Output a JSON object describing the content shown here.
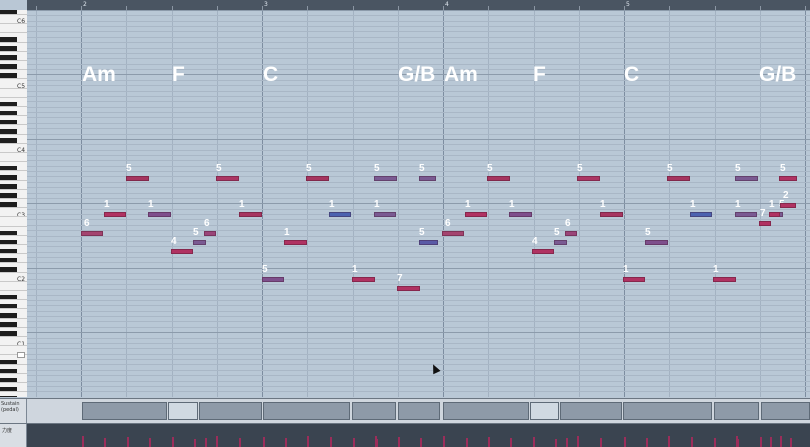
{
  "ruler": {
    "bars": [
      "2",
      "3",
      "4",
      "5"
    ]
  },
  "keyboard": {
    "octave_labels": [
      "C6",
      "C5",
      "C4",
      "C3",
      "C2",
      "C1"
    ]
  },
  "chords": [
    "Am",
    "F",
    "C",
    "G/B",
    "Am",
    "F",
    "C",
    "G/B"
  ],
  "notes": [
    {
      "finger": "6",
      "color": "#a4446f"
    },
    {
      "finger": "1",
      "color": "#b03262"
    },
    {
      "finger": "5",
      "color": "#a6345f"
    },
    {
      "finger": "1",
      "color": "#7e4f8c"
    },
    {
      "finger": "4",
      "color": "#b03262"
    },
    {
      "finger": "5",
      "color": "#7a5a92"
    },
    {
      "finger": "6",
      "color": "#9a4478"
    },
    {
      "finger": "5",
      "color": "#ac3664"
    },
    {
      "finger": "1",
      "color": "#a6345f"
    },
    {
      "finger": "5",
      "color": "#7e4f8c"
    },
    {
      "finger": "1",
      "color": "#b03262"
    },
    {
      "finger": "5",
      "color": "#a6345f"
    },
    {
      "finger": "1",
      "color": "#4c62b0"
    },
    {
      "finger": "1",
      "color": "#b03262"
    },
    {
      "finger": "5",
      "color": "#7a5a92"
    },
    {
      "finger": "1",
      "color": "#7a5a92"
    },
    {
      "finger": "5",
      "color": "#7a5a92"
    },
    {
      "finger": "7",
      "color": "#b03262"
    },
    {
      "finger": "5",
      "color": "#5a5aa6"
    },
    {
      "finger": "6",
      "color": "#a4446f"
    },
    {
      "finger": "1",
      "color": "#b03262"
    },
    {
      "finger": "5",
      "color": "#a6345f"
    },
    {
      "finger": "1",
      "color": "#7e4f8c"
    },
    {
      "finger": "4",
      "color": "#b03262"
    },
    {
      "finger": "5",
      "color": "#7a5a92"
    },
    {
      "finger": "6",
      "color": "#9a4478"
    },
    {
      "finger": "5",
      "color": "#ac3664"
    },
    {
      "finger": "1",
      "color": "#a6345f"
    },
    {
      "finger": "5",
      "color": "#7e4f8c"
    },
    {
      "finger": "1",
      "color": "#b03262"
    },
    {
      "finger": "5",
      "color": "#a6345f"
    },
    {
      "finger": "1",
      "color": "#4c62b0"
    },
    {
      "finger": "1",
      "color": "#b03262"
    },
    {
      "finger": "5",
      "color": "#7a5a92"
    },
    {
      "finger": "1",
      "color": "#7a5a92"
    },
    {
      "finger": "5",
      "color": "#7a5a92"
    },
    {
      "finger": "7",
      "color": "#b03262"
    },
    {
      "finger": "1",
      "color": "#b03262"
    },
    {
      "finger": "2",
      "color": "#b03262"
    },
    {
      "finger": "5",
      "color": "#b03262"
    }
  ],
  "sustain": {
    "label": "Sustain\n(pedal)"
  },
  "velocity": {
    "label": "力度"
  },
  "colors": {
    "grid_bg": "#b9c8d6",
    "bar_line": "#8393a4",
    "ruler": "#4a5562",
    "velocity_bar": "#9b2d5a"
  }
}
